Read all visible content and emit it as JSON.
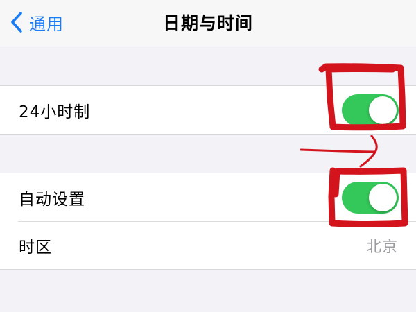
{
  "navbar": {
    "back_label": "通用",
    "title": "日期与时间"
  },
  "groups": [
    {
      "rows": [
        {
          "label": "24小时制",
          "toggle_on": true
        }
      ]
    },
    {
      "rows": [
        {
          "label": "自动设置",
          "toggle_on": true
        },
        {
          "label": "时区",
          "value": "北京"
        }
      ]
    }
  ],
  "colors": {
    "accent_blue": "#1a7cf5",
    "toggle_on_green": "#34c759",
    "annotation_red": "#d4141c",
    "background": "#f2f2f7"
  },
  "icons": {
    "back": "chevron-left-icon"
  }
}
